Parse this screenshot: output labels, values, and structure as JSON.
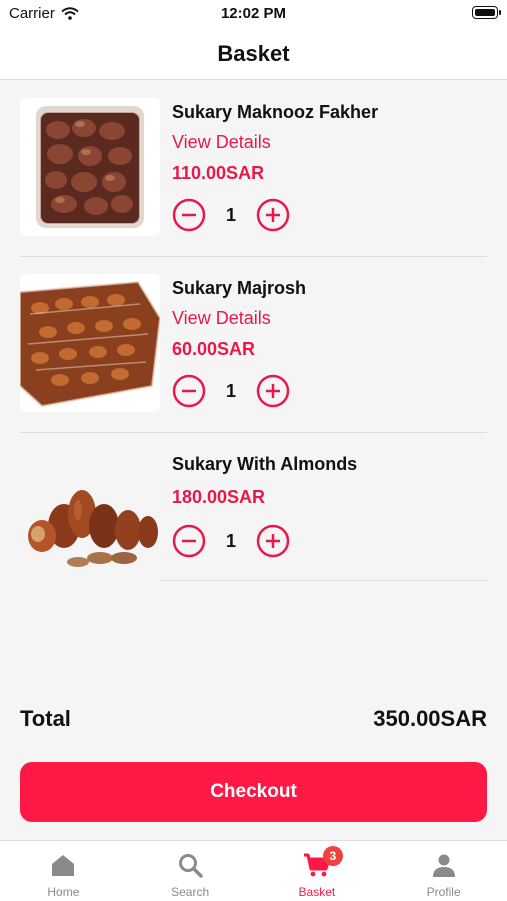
{
  "status_bar": {
    "carrier": "Carrier",
    "time": "12:02 PM"
  },
  "header": {
    "title": "Basket"
  },
  "basket": {
    "items": [
      {
        "name": "Sukary Maknooz Fakher",
        "link": "View Details",
        "price": "110.00SAR",
        "quantity": "1"
      },
      {
        "name": "Sukary Majrosh",
        "link": "View Details",
        "price": "60.00SAR",
        "quantity": "1"
      },
      {
        "name": "Sukary With Almonds",
        "price": "180.00SAR",
        "quantity": "1"
      }
    ],
    "total_label": "Total",
    "total_value": "350.00SAR",
    "checkout_label": "Checkout"
  },
  "tab_bar": {
    "tabs": [
      {
        "label": "Home",
        "icon": "home-icon"
      },
      {
        "label": "Search",
        "icon": "search-icon"
      },
      {
        "label": "Basket",
        "icon": "cart-icon",
        "badge": "3",
        "active": true
      },
      {
        "label": "Profile",
        "icon": "person-icon"
      }
    ]
  },
  "colors": {
    "accent": "#fd1845",
    "text": "#111111",
    "background": "#f5f5f5",
    "inactive": "#8a8a8a"
  }
}
